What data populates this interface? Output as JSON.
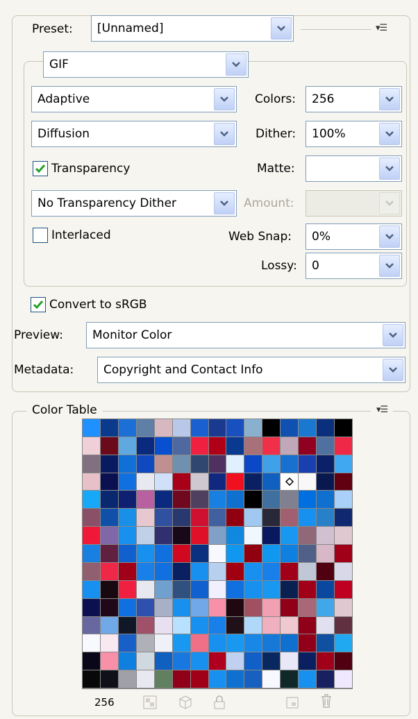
{
  "preset": {
    "label": "Preset:",
    "value": "[Unnamed]"
  },
  "format": {
    "value": "GIF"
  },
  "reduction": {
    "value": "Adaptive"
  },
  "colors": {
    "label": "Colors:",
    "value": "256"
  },
  "dither_algorithm": {
    "value": "Diffusion"
  },
  "dither": {
    "label": "Dither:",
    "value": "100%"
  },
  "transparency": {
    "label": "Transparency",
    "checked": true
  },
  "matte": {
    "label": "Matte:",
    "value": ""
  },
  "transparency_dither": {
    "value": "No Transparency Dither"
  },
  "amount": {
    "label": "Amount:",
    "value": ""
  },
  "interlaced": {
    "label": "Interlaced",
    "checked": false
  },
  "web_snap": {
    "label": "Web Snap:",
    "value": "0%"
  },
  "lossy": {
    "label": "Lossy:",
    "value": "0"
  },
  "convert_srgb": {
    "label": "Convert to sRGB",
    "checked": true
  },
  "preview": {
    "label": "Preview:",
    "value": "Monitor Color"
  },
  "metadata": {
    "label": "Metadata:",
    "value": "Copyright and Contact Info"
  },
  "color_table": {
    "title": "Color Table",
    "count": "256",
    "selected_index": 56,
    "colors": [
      "#1e90ff",
      "#0b3a8c",
      "#1c6fd6",
      "#5f7fa6",
      "#d8b8c0",
      "#b8c8e8",
      "#1a60d0",
      "#1a3a90",
      "#1850c0",
      "#8ab0d0",
      "#000000",
      "#1050b0",
      "#1a78d0",
      "#0a2f7c",
      "#000000",
      "#f0d0d8",
      "#6a0a1a",
      "#60a8e0",
      "#0a2a80",
      "#0850d0",
      "#5068a0",
      "#f02040",
      "#b00018",
      "#0a3a90",
      "#a87078",
      "#f03048",
      "#c0a8b8",
      "#900020",
      "#5070a0",
      "#f02848",
      "#807080",
      "#0a1a60",
      "#1070d8",
      "#1048c0",
      "#c09090",
      "#7090b0",
      "#304870",
      "#503060",
      "#e0f0ff",
      "#0a48c8",
      "#40a0e8",
      "#1870d0",
      "#1840b0",
      "#0a2068",
      "#40a8f0",
      "#e8c0c8",
      "#0a1050",
      "#1070e0",
      "#e8e8f0",
      "#d0e0f8",
      "#a80018",
      "#d0c8d0",
      "#102880",
      "#f01020",
      "#0a2060",
      "#1060c0",
      "#204090",
      "#f8f8f8",
      "#0a1850",
      "#600010",
      "#18a8f8",
      "#0a2870",
      "#102070",
      "#b860a0",
      "#0a2a80",
      "#700820",
      "#504060",
      "#1880e0",
      "#1070d0",
      "#000000",
      "#4070a0",
      "#808090",
      "#0070e0",
      "#1070d0",
      "#a8d0f8",
      "#8a5068",
      "#1050a8",
      "#1890e8",
      "#e8c8d0",
      "#3050a0",
      "#2a3870",
      "#d01030",
      "#4060a0",
      "#900010",
      "#a0c8f0",
      "#282838",
      "#a06070",
      "#1890f0",
      "#2880c8",
      "#102870",
      "#f01838",
      "#8068a8",
      "#1890f0",
      "#c0d0e8",
      "#303070",
      "#180818",
      "#e01028",
      "#80a0c8",
      "#1088e0",
      "#f0f8ff",
      "#0a1860",
      "#1898f0",
      "#906878",
      "#d0c0d0",
      "#e0c8d0",
      "#1880e0",
      "#602040",
      "#1060d0",
      "#1890f0",
      "#1070e0",
      "#d00820",
      "#0a3080",
      "#f8f8ff",
      "#1098f0",
      "#900010",
      "#1098f0",
      "#1080e0",
      "#506088",
      "#d8b8c8",
      "#a00018",
      "#906070",
      "#f02848",
      "#a00018",
      "#1880e8",
      "#1070e0",
      "#0a2060",
      "#1890f0",
      "#b8d0f0",
      "#a00010",
      "#1890f0",
      "#1880e8",
      "#a00018",
      "#c0c8d8",
      "#500010",
      "#d8d8e8",
      "#1890f0",
      "#180810",
      "#f02040",
      "#e8e8f0",
      "#70a0d0",
      "#305080",
      "#1060d0",
      "#f0f0ff",
      "#1070e0",
      "#1890f0",
      "#1898f0",
      "#0a2050",
      "#a00018",
      "#0a48a0",
      "#c00020",
      "#0a1050",
      "#200818",
      "#1070e0",
      "#3050b0",
      "#a8b0c8",
      "#1890f0",
      "#70a8e8",
      "#f890a8",
      "#200810",
      "#a05060",
      "#f0a0b0",
      "#900018",
      "#a86878",
      "#40a8e8",
      "#e0c8d0",
      "#6868a0",
      "#70a8e8",
      "#101828",
      "#a05068",
      "#e8e0f0",
      "#b8e0ff",
      "#1890f0",
      "#1880e8",
      "#201018",
      "#b0d8f8",
      "#f0b0c0",
      "#f0c8d0",
      "#900018",
      "#e0e0f0",
      "#603040",
      "#f8f8ff",
      "#f8e8f0",
      "#1860c8",
      "#b0b0b8",
      "#f0f0f8",
      "#1898f0",
      "#f07088",
      "#1890f0",
      "#1898f0",
      "#1888e8",
      "#1878d8",
      "#1070d0",
      "#900018",
      "#1050a0",
      "#20a8f0",
      "#0a0818",
      "#f890a8",
      "#1080e0",
      "#d0d8e0",
      "#1060c0",
      "#1878e0",
      "#1890f0",
      "#b00020",
      "#c0d0f0",
      "#1060c8",
      "#0a2860",
      "#e8e8f8",
      "#0a2060",
      "#a00018",
      "#500010",
      "#080808",
      "#101018",
      "#a0a0a8",
      "#e8e8f0",
      "#608060",
      "#900018",
      "#a00018",
      "#1890f0",
      "#1070d0",
      "#1860c0",
      "#f8f8ff",
      "#102828",
      "#1890f0",
      "#182060",
      "#f0e8ff"
    ],
    "last_row": [
      "#58a8e8",
      "#701020",
      "#10b8f0",
      "#4878c8",
      "#f8f8f8",
      "#102060",
      "#0a2068",
      "#1898f0",
      "#a00018",
      "#c8c8c8",
      "#f8f8f8",
      "#303038",
      "#404040",
      "#602020",
      "#401018"
    ]
  }
}
